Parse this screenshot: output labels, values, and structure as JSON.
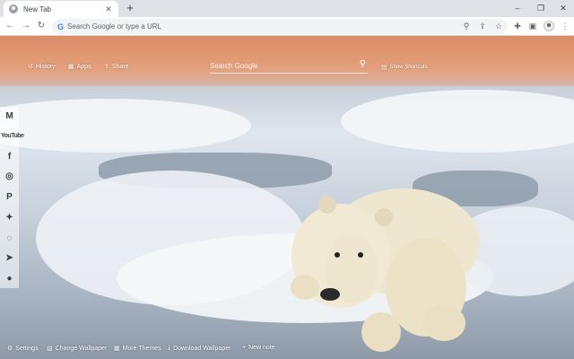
{
  "browser": {
    "tab": {
      "title": "New Tab",
      "close": "✕"
    },
    "new_tab": "+",
    "window_controls": {
      "minimize": "–",
      "restore": "❐",
      "close": "✕"
    },
    "nav": {
      "back": "←",
      "forward": "→",
      "reload": "↻"
    },
    "omnibox": {
      "placeholder": "Search Google or type a URL",
      "g_icon": "G"
    },
    "omnibox_icons": {
      "zoom": "⚲",
      "share": "⇪",
      "bookmark": "☆"
    },
    "toolbar_icons": {
      "extensions": "✚",
      "sidepanel": "▣",
      "menu": "⋮"
    }
  },
  "newtab": {
    "links": {
      "history": {
        "icon": "↺",
        "label": "History"
      },
      "apps": {
        "icon": "▦",
        "label": "Apps"
      },
      "share": {
        "icon": "⇪",
        "label": "Share"
      },
      "show_shortcuts": {
        "icon": "▤",
        "label": "Show Shortcuts"
      }
    },
    "search": {
      "placeholder": "Search Google",
      "icon": "⚲"
    },
    "social": [
      {
        "name": "gmail-icon",
        "glyph": "M"
      },
      {
        "name": "youtube-icon",
        "glyph": "YouTube"
      },
      {
        "name": "facebook-icon",
        "glyph": "f"
      },
      {
        "name": "instagram-icon",
        "glyph": "◎"
      },
      {
        "name": "pinterest-icon",
        "glyph": "P"
      },
      {
        "name": "twitter-icon",
        "glyph": "✦"
      },
      {
        "name": "whatsapp-icon",
        "glyph": "◌"
      },
      {
        "name": "telegram-icon",
        "glyph": "➤"
      },
      {
        "name": "reddit-icon",
        "glyph": "●"
      }
    ],
    "bottom": {
      "settings": {
        "icon": "⚙",
        "label": "Settings"
      },
      "change_wallpaper": {
        "icon": "▧",
        "label": "Change Wallpaper"
      },
      "more_themes": {
        "icon": "▦",
        "label": "More Themes"
      },
      "download_wallpaper": {
        "icon": "⤓",
        "label": "Download Wallpaper"
      },
      "new_note": {
        "icon": "+",
        "label": "New note"
      }
    }
  }
}
